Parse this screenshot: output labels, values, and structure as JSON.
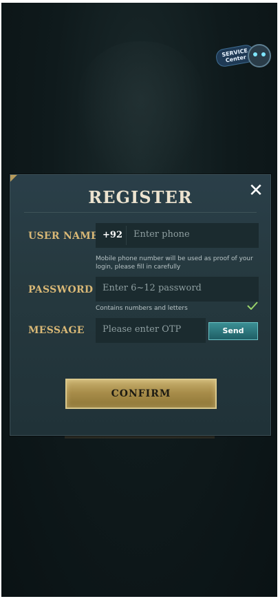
{
  "dialog": {
    "title": "REGISTER",
    "close_symbol": "✕"
  },
  "service_badge": {
    "line1": "SERVICE",
    "line2": "Center"
  },
  "username": {
    "label": "USER NAME",
    "country_code": "+92",
    "placeholder": "Enter phone",
    "hint": "Mobile phone number will be used as proof of your login, please fill in carefully"
  },
  "password": {
    "label": "PASSWORD",
    "placeholder": "Enter 6~12 password",
    "hint": "Contains numbers and letters"
  },
  "message": {
    "label": "MESSAGE",
    "placeholder": "Please enter OTP",
    "send_label": "Send"
  },
  "confirm_label": "CONFIRM",
  "colors": {
    "gold_label": "#d9b876",
    "accent_teal": "#3b8f94",
    "check_green": "#9bd46a"
  }
}
